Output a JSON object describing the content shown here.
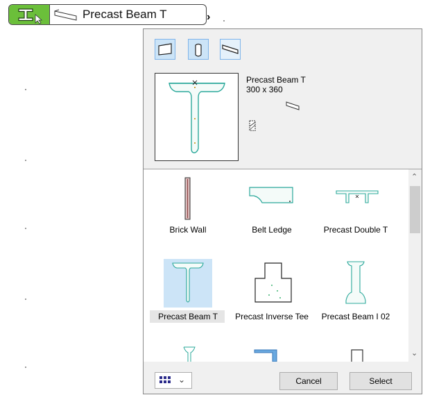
{
  "toolbar": {
    "tool_icon": "i-beam-tool-icon",
    "element_icon": "beam-profile-icon",
    "element_label": "Precast Beam T",
    "accent_color": "#6bbf3a"
  },
  "panel": {
    "type_buttons": [
      {
        "name": "rectangular-profile-icon"
      },
      {
        "name": "rounded-profile-icon"
      },
      {
        "name": "beam-profile-icon"
      }
    ],
    "preview": {
      "name": "Precast Beam T",
      "size": "300 x 360",
      "icons": [
        "beam-3d-icon",
        "hatch-pattern-icon"
      ]
    },
    "gallery": {
      "items": [
        {
          "label": "Brick Wall"
        },
        {
          "label": "Belt Ledge"
        },
        {
          "label": "Precast Double T"
        },
        {
          "label": "Precast Beam T",
          "selected": true
        },
        {
          "label": "Precast Inverse Tee"
        },
        {
          "label": "Precast Beam I 02"
        }
      ]
    },
    "footer": {
      "view_icon": "grid-view-icon",
      "cancel_label": "Cancel",
      "select_label": "Select"
    }
  }
}
